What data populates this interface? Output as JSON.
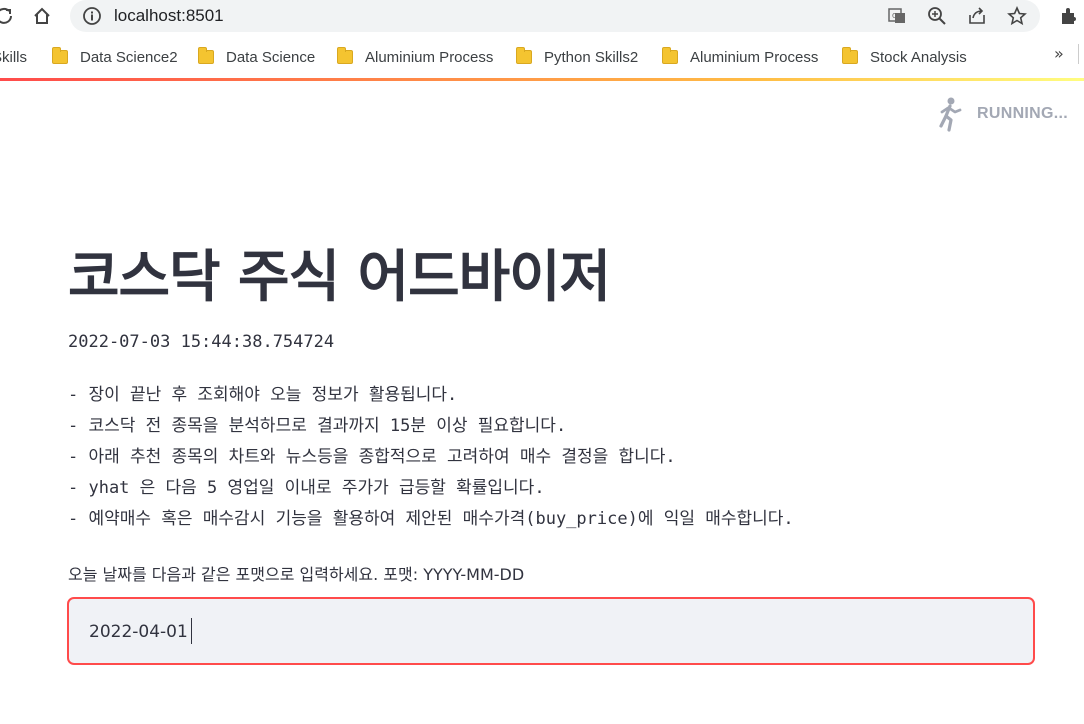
{
  "browser": {
    "url": "localhost:8501",
    "bookmarks": [
      {
        "label": "Skills"
      },
      {
        "label": "Data Science2"
      },
      {
        "label": "Data Science"
      },
      {
        "label": "Aluminium Process"
      },
      {
        "label": "Python Skills2"
      },
      {
        "label": "Aluminium Process"
      },
      {
        "label": "Stock Analysis"
      }
    ],
    "more_label": "»"
  },
  "status": {
    "label": "RUNNING..."
  },
  "main": {
    "title": "코스닥 주식 어드바이저",
    "timestamp": "2022-07-03 15:44:38.754724",
    "notes": [
      "- 장이 끝난 후 조회해야 오늘 정보가 활용됩니다.",
      "- 코스닥 전 종목을 분석하므로 결과까지 15분 이상 필요합니다.",
      "- 아래 추천 종목의 차트와 뉴스등을 종합적으로 고려하여 매수 결정을 합니다.",
      "- yhat 은 다음 5 영업일 이내로 주가가 급등할 확률입니다.",
      "- 예약매수 혹은 매수감시 기능을 활용하여 제안된 매수가격(buy_price)에 익일 매수합니다."
    ],
    "input_label": "오늘 날짜를 다음과 같은 포맷으로 입력하세요. 포맷: YYYY-MM-DD",
    "input_value": "2022-04-01"
  },
  "colors": {
    "accent": "#ff4b4b",
    "text": "#31333f",
    "status": "#a3a8b4",
    "input_bg": "#f0f2f6"
  }
}
